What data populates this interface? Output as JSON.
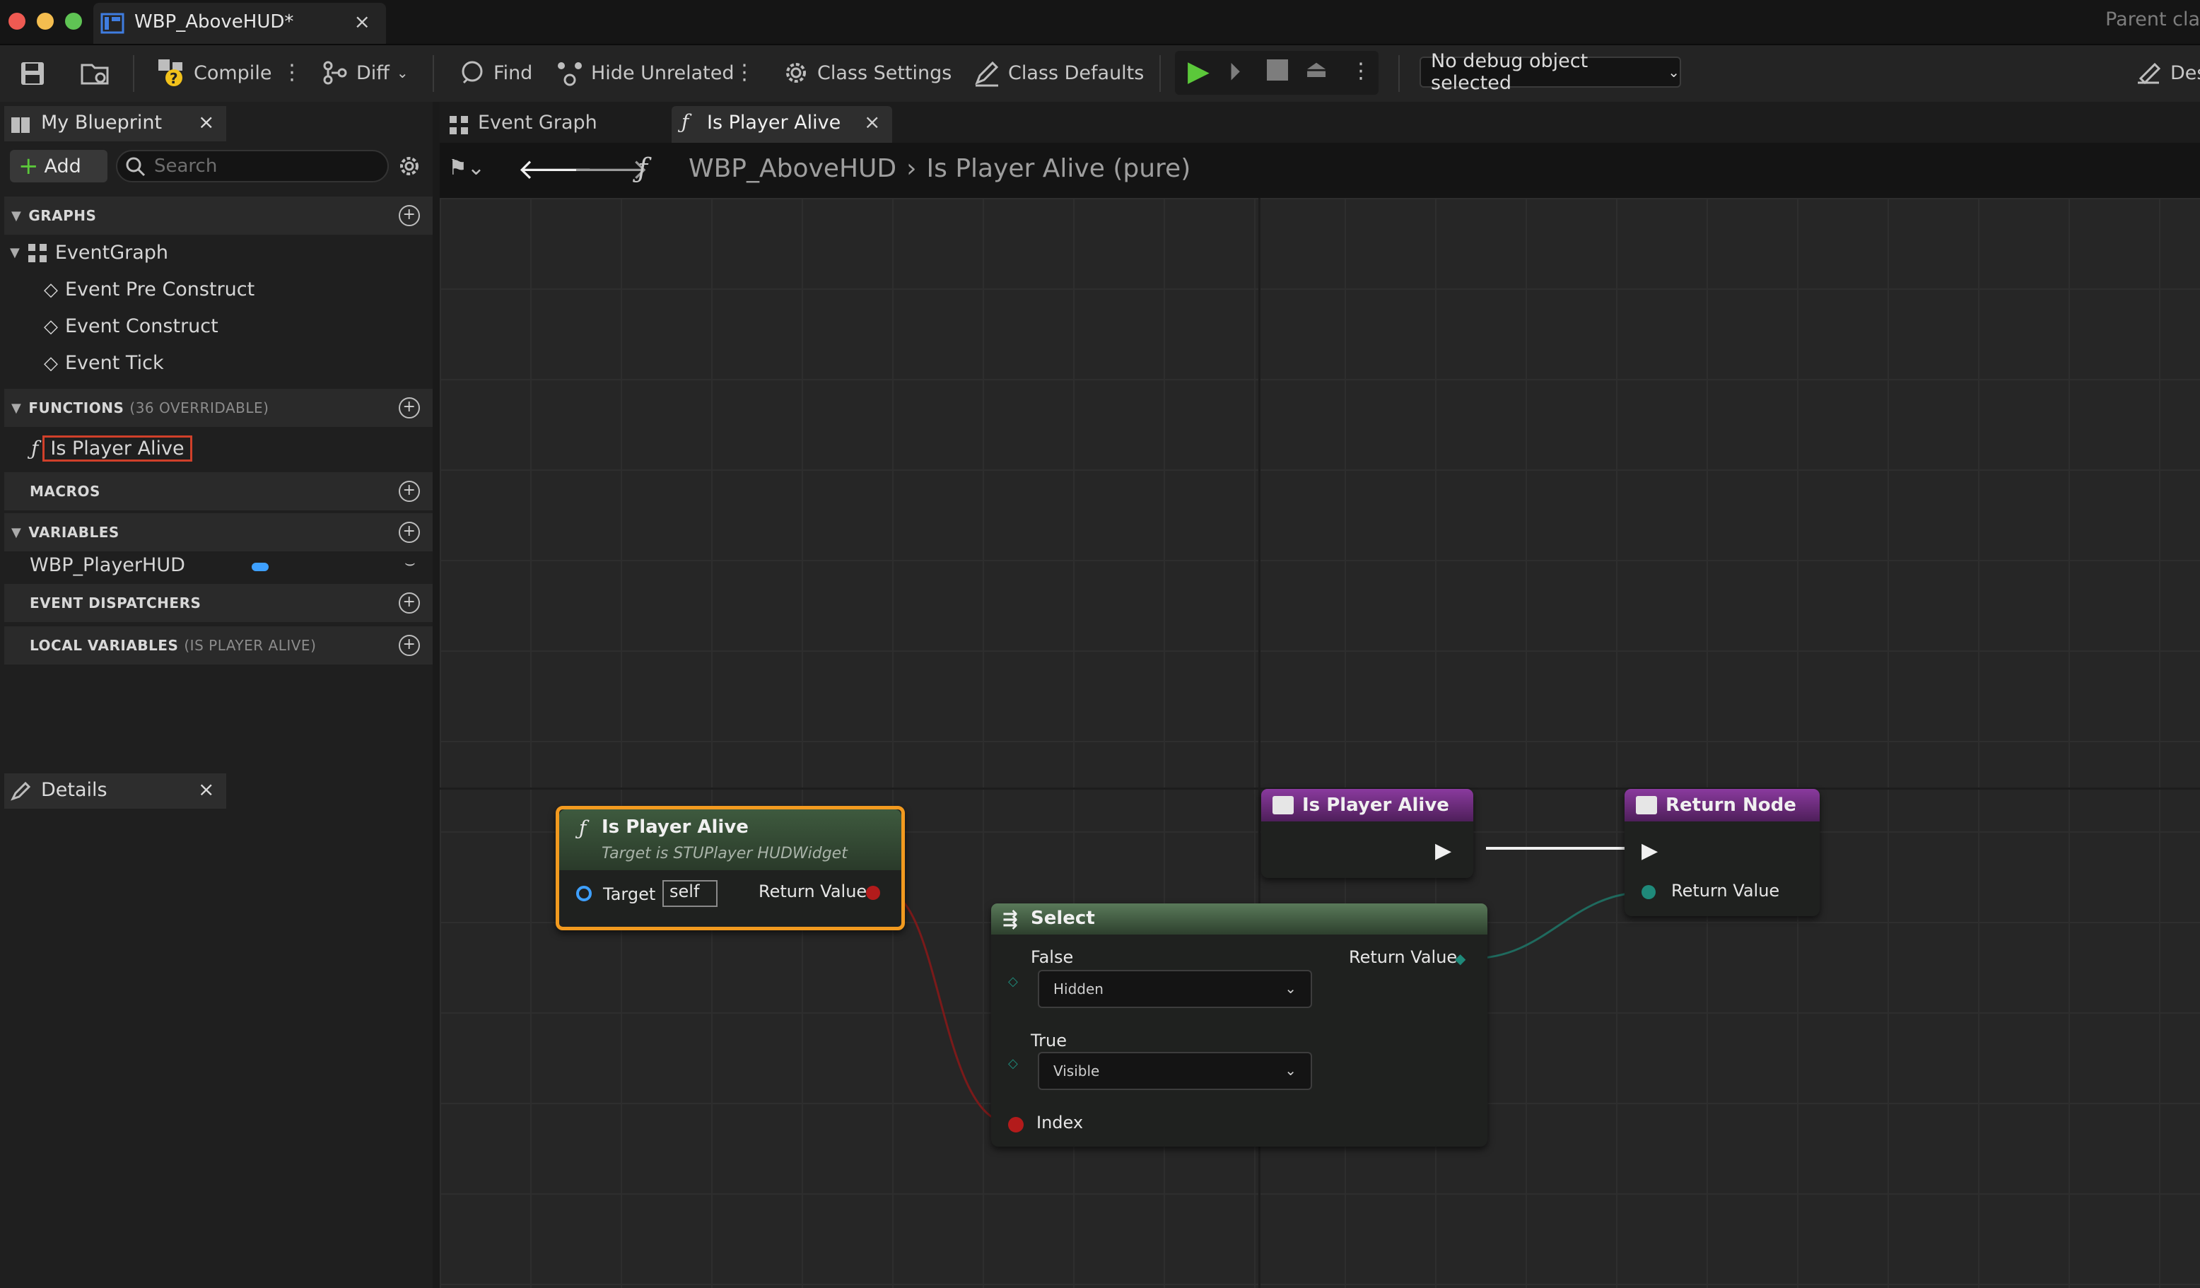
{
  "window": {
    "tab_title": "WBP_AboveHUD*",
    "parent_class": "Parent cla"
  },
  "toolbar": {
    "compile": "Compile",
    "diff": "Diff",
    "find": "Find",
    "hide_unrelated": "Hide Unrelated",
    "class_settings": "Class Settings",
    "class_defaults": "Class Defaults",
    "debug_object": "No debug object selected",
    "designer": "Des"
  },
  "my_blueprint": {
    "tab": "My Blueprint",
    "add": "Add",
    "search_placeholder": "Search",
    "sections": {
      "graphs": "GRAPHS",
      "functions": "FUNCTIONS",
      "functions_sub": "(36 OVERRIDABLE)",
      "macros": "MACROS",
      "variables": "VARIABLES",
      "dispatchers": "EVENT DISPATCHERS",
      "local_vars": "LOCAL VARIABLES",
      "local_vars_sub": "(IS PLAYER ALIVE)"
    },
    "graph_items": [
      "EventGraph",
      "Event Pre Construct",
      "Event Construct",
      "Event Tick"
    ],
    "function_item": "Is Player Alive",
    "variable_item": "WBP_PlayerHUD"
  },
  "details": {
    "tab": "Details"
  },
  "editor_tabs": [
    "Event Graph",
    "Is Player Alive"
  ],
  "breadcrumb": {
    "root": "WBP_AboveHUD",
    "current": "Is Player Alive (pure)"
  },
  "nodes": {
    "call": {
      "title": "Is Player Alive",
      "subtitle": "Target is STUPlayer HUDWidget",
      "target_label": "Target",
      "target_value": "self",
      "return_label": "Return Value"
    },
    "entry": {
      "title": "Is Player Alive"
    },
    "return_node": {
      "title": "Return Node",
      "return_label": "Return Value"
    },
    "select": {
      "title": "Select",
      "false_label": "False",
      "false_value": "Hidden",
      "true_label": "True",
      "true_value": "Visible",
      "index_label": "Index",
      "return_label": "Return Value"
    }
  },
  "colors": {
    "accent_orange": "#f29a1f",
    "function_green": "#3c5a3c",
    "entry_purple": "#7b2d8e",
    "bool_pin": "#b31b1b",
    "enum_pin": "#1f8a7a",
    "highlight_box": "#d0402a"
  }
}
